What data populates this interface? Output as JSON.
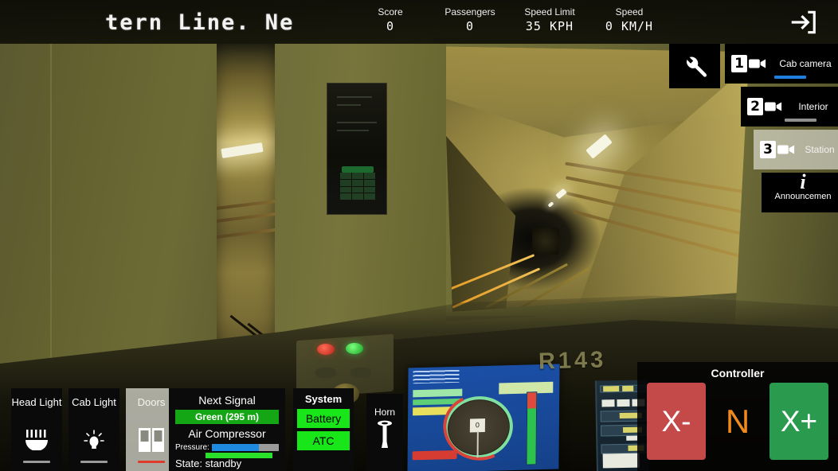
{
  "topbar": {
    "marquee_text": "tern Line. Ne",
    "stats": [
      {
        "label": "Score",
        "value": "0"
      },
      {
        "label": "Passengers",
        "value": "0"
      },
      {
        "label": "Speed Limit",
        "value": "35 KPH"
      },
      {
        "label": "Speed",
        "value": "0 KM/H"
      }
    ],
    "exit_icon": "exit-arrow-icon"
  },
  "camera_panel": {
    "tool_icon": "wrench-icon",
    "items": [
      {
        "number": "1",
        "label": "Cab camera",
        "icon": "video-camera-icon",
        "underline_color": "#1e7fdf",
        "active": true
      },
      {
        "number": "2",
        "label": "Interior",
        "icon": "video-camera-icon",
        "underline_color": "#909090",
        "active": false
      },
      {
        "number": "3",
        "label": "Station",
        "icon": "video-camera-icon",
        "underline_color": "",
        "active": false
      }
    ],
    "announcement": {
      "icon": "info-italic-icon",
      "label": "Announcemen"
    }
  },
  "bottom_controls": [
    {
      "label": "Head Light",
      "icon": "headlight-icon",
      "underline": "grey"
    },
    {
      "label": "Cab Light",
      "icon": "bulb-icon",
      "underline": "grey"
    },
    {
      "label": "Doors",
      "icon": "doors-icon",
      "underline": "red"
    }
  ],
  "signal_panel": {
    "title": "Next Signal",
    "state": "Green (295 m)",
    "state_color": "#15a615",
    "compressor_title": "Air Compressor",
    "pressure_label": "Pressure:",
    "pressure_percent": 70,
    "state_row": "State: standby"
  },
  "system_panel": {
    "title": "System",
    "buttons": [
      {
        "label": "Battery",
        "color": "#19e619"
      },
      {
        "label": "ATC",
        "color": "#19e619"
      }
    ]
  },
  "horn_panel": {
    "label": "Horn",
    "icon": "horn-icon"
  },
  "controller_panel": {
    "title": "Controller",
    "decrease_label": "X-",
    "neutral_label": "N",
    "increase_label": "X+",
    "decrease_color": "#c44a4a",
    "neutral_color": "#f08a1e",
    "increase_color": "#2a9a4e"
  },
  "cab": {
    "car_number": "R143",
    "mfd_center_value": "0"
  }
}
